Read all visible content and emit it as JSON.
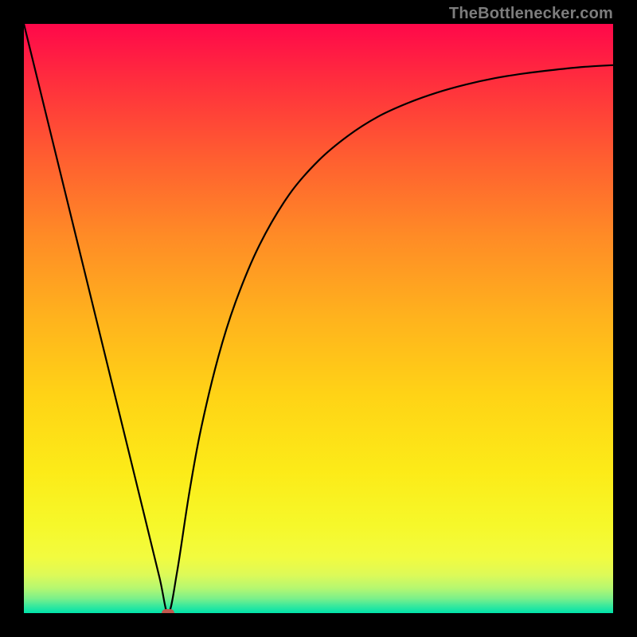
{
  "watermark": "TheBottlenecker.com",
  "colors": {
    "curve_stroke": "#000000",
    "marker_fill": "#c1584e"
  },
  "gradient_stops": [
    {
      "offset": 0.0,
      "color": "#ff084a"
    },
    {
      "offset": 0.1,
      "color": "#ff2f3d"
    },
    {
      "offset": 0.23,
      "color": "#ff5f30"
    },
    {
      "offset": 0.36,
      "color": "#ff8b26"
    },
    {
      "offset": 0.5,
      "color": "#ffb31d"
    },
    {
      "offset": 0.63,
      "color": "#ffd316"
    },
    {
      "offset": 0.76,
      "color": "#fceb18"
    },
    {
      "offset": 0.85,
      "color": "#f6f82a"
    },
    {
      "offset": 0.905,
      "color": "#f2fb3f"
    },
    {
      "offset": 0.935,
      "color": "#ddfa58"
    },
    {
      "offset": 0.958,
      "color": "#b4f771"
    },
    {
      "offset": 0.975,
      "color": "#7cf08a"
    },
    {
      "offset": 0.99,
      "color": "#2de7a0"
    },
    {
      "offset": 1.0,
      "color": "#00e3aa"
    }
  ],
  "chart_data": {
    "type": "line",
    "title": "",
    "xlabel": "",
    "ylabel": "",
    "xlim": [
      0,
      100
    ],
    "ylim": [
      0,
      100
    ],
    "grid": false,
    "legend": false,
    "series": [
      {
        "name": "bottleneck-curve",
        "x": [
          0,
          5,
          10,
          15,
          20,
          23,
          24.5,
          26,
          28,
          30,
          33,
          36,
          40,
          45,
          50,
          55,
          60,
          65,
          70,
          75,
          80,
          85,
          90,
          95,
          100
        ],
        "y": [
          100,
          79.6,
          59.2,
          38.8,
          18.4,
          6.1,
          0.0,
          7.0,
          20.0,
          31.0,
          43.5,
          53.0,
          62.5,
          71.0,
          76.8,
          81.0,
          84.2,
          86.5,
          88.3,
          89.7,
          90.8,
          91.6,
          92.2,
          92.7,
          93.0
        ]
      }
    ],
    "annotations": [
      {
        "name": "min-point",
        "x": 24.5,
        "y": 0.0
      }
    ]
  }
}
